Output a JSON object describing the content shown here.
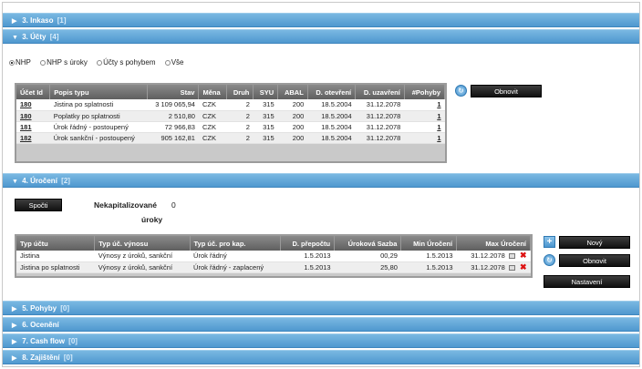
{
  "sections": [
    {
      "label": "3. Inkaso",
      "count": "[1]",
      "expanded": false
    },
    {
      "label": "3. Účty",
      "count": "[4]",
      "expanded": true
    },
    {
      "label": "4. Úročení",
      "count": "[2]",
      "expanded": true
    },
    {
      "label": "5. Pohyby",
      "count": "[0]",
      "expanded": false
    },
    {
      "label": "6. Ocenění",
      "count": "",
      "expanded": false
    },
    {
      "label": "7. Cash flow",
      "count": "[0]",
      "expanded": false
    },
    {
      "label": "8. Zajištění",
      "count": "[0]",
      "expanded": false
    }
  ],
  "accounts": {
    "filters": [
      {
        "label": "NHP",
        "selected": true
      },
      {
        "label": "NHP s úroky",
        "selected": false
      },
      {
        "label": "Účty s pohybem",
        "selected": false
      },
      {
        "label": "Vše",
        "selected": false
      }
    ],
    "columns": [
      "Účet Id",
      "Popis typu",
      "Stav",
      "Měna",
      "Druh",
      "SYU",
      "ABAL",
      "D. otevření",
      "D. uzavření",
      "#Pohyby"
    ],
    "rows": [
      {
        "id": "180",
        "type": "Jistina po splatnosti",
        "balance": "3 109 065,94",
        "currency": "CZK",
        "kind": "2",
        "syu": "315",
        "abal": "200",
        "opened": "18.5.2004",
        "closed": "31.12.2078",
        "moves": "1"
      },
      {
        "id": "180",
        "type": "Poplatky po splatnosti",
        "balance": "2 510,80",
        "currency": "CZK",
        "kind": "2",
        "syu": "315",
        "abal": "200",
        "opened": "18.5.2004",
        "closed": "31.12.2078",
        "moves": "1"
      },
      {
        "id": "181",
        "type": "Úrok řádný - postoupený",
        "balance": "72 966,83",
        "currency": "CZK",
        "kind": "2",
        "syu": "315",
        "abal": "200",
        "opened": "18.5.2004",
        "closed": "31.12.2078",
        "moves": "1"
      },
      {
        "id": "182",
        "type": "Úrok sankční - postoupený",
        "balance": "905 162,81",
        "currency": "CZK",
        "kind": "2",
        "syu": "315",
        "abal": "200",
        "opened": "18.5.2004",
        "closed": "31.12.2078",
        "moves": "1"
      }
    ],
    "refresh_label": "Obnovit"
  },
  "interest": {
    "calc_label": "Spočti",
    "uncap_label_1": "Nekapitalizované",
    "uncap_label_2": "úroky",
    "uncap_value": "0",
    "columns": [
      "Typ účtu",
      "Typ úč. výnosu",
      "Typ úč. pro kap.",
      "D. přepočtu",
      "Úroková Sazba",
      "Min Úročení",
      "Max Úročení"
    ],
    "rows": [
      {
        "acc": "Jistina",
        "yield": "Výnosy z úroků, sankční",
        "cap": "Úrok řádný",
        "recalc": "1.5.2013",
        "rate": "00,29",
        "min": "1.5.2013",
        "max": "31.12.2078"
      },
      {
        "acc": "Jistina po splatnosti",
        "yield": "Výnosy z úroků, sankční",
        "cap": "Úrok řádný - zaplacený",
        "recalc": "1.5.2013",
        "rate": "25,80",
        "min": "1.5.2013",
        "max": "31.12.2078"
      }
    ],
    "new_label": "Nový",
    "refresh_label": "Obnovit",
    "setup_label": "Nastavení"
  }
}
